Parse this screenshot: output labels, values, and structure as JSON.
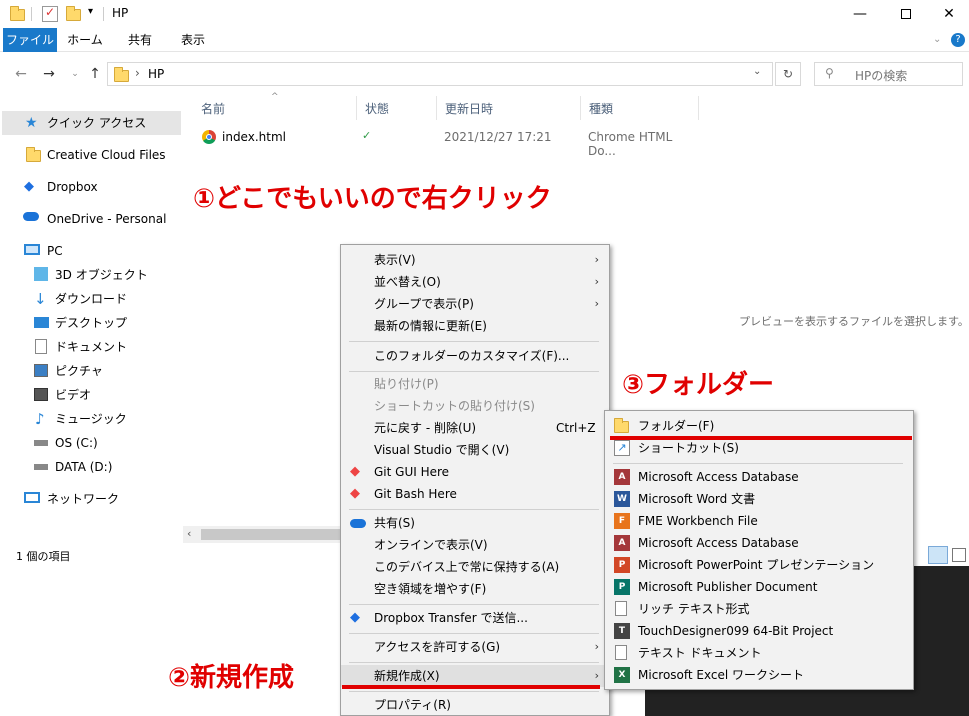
{
  "title": "HP",
  "ribbon": {
    "tabs": [
      "ファイル",
      "ホーム",
      "共有",
      "表示"
    ]
  },
  "address": {
    "path": "HP",
    "separator": "›"
  },
  "search": {
    "placeholder": "HPの検索"
  },
  "sidebar": {
    "items": [
      {
        "label": "クイック アクセス",
        "icon": "star-icon"
      },
      {
        "label": "Creative Cloud Files",
        "icon": "creative-cloud-icon"
      },
      {
        "label": "Dropbox",
        "icon": "dropbox-icon"
      },
      {
        "label": "OneDrive - Personal",
        "icon": "onedrive-icon"
      },
      {
        "label": "PC",
        "icon": "pc-icon"
      },
      {
        "label": "3D オブジェクト",
        "icon": "3d-objects-icon"
      },
      {
        "label": "ダウンロード",
        "icon": "download-icon"
      },
      {
        "label": "デスクトップ",
        "icon": "desktop-icon"
      },
      {
        "label": "ドキュメント",
        "icon": "documents-icon"
      },
      {
        "label": "ピクチャ",
        "icon": "pictures-icon"
      },
      {
        "label": "ビデオ",
        "icon": "videos-icon"
      },
      {
        "label": "ミュージック",
        "icon": "music-icon"
      },
      {
        "label": "OS (C:)",
        "icon": "drive-icon"
      },
      {
        "label": "DATA (D:)",
        "icon": "drive-icon"
      },
      {
        "label": "ネットワーク",
        "icon": "network-icon"
      }
    ]
  },
  "columns": [
    "名前",
    "状態",
    "更新日時",
    "種類"
  ],
  "files": [
    {
      "name": "index.html",
      "status": "✓",
      "modified": "2021/12/27 17:21",
      "type": "Chrome HTML Do..."
    }
  ],
  "preview_text": "プレビューを表示するファイルを選択します。",
  "status_bar": {
    "count": "1 個の項目"
  },
  "context_menu": {
    "items": [
      {
        "label": "表示(V)",
        "submenu": true
      },
      {
        "label": "並べ替え(O)",
        "submenu": true
      },
      {
        "label": "グループで表示(P)",
        "submenu": true
      },
      {
        "label": "最新の情報に更新(E)"
      },
      {
        "label": "このフォルダーのカスタマイズ(F)..."
      },
      {
        "label": "貼り付け(P)",
        "disabled": true
      },
      {
        "label": "ショートカットの貼り付け(S)",
        "disabled": true
      },
      {
        "label": "元に戻す - 削除(U)",
        "shortcut": "Ctrl+Z"
      },
      {
        "label": "Visual Studio で開く(V)"
      },
      {
        "label": "Git GUI Here"
      },
      {
        "label": "Git Bash Here"
      },
      {
        "label": "共有(S)"
      },
      {
        "label": "オンラインで表示(V)"
      },
      {
        "label": "このデバイス上で常に保持する(A)"
      },
      {
        "label": "空き領域を増やす(F)"
      },
      {
        "label": "Dropbox Transfer で送信..."
      },
      {
        "label": "アクセスを許可する(G)",
        "submenu": true
      },
      {
        "label": "新規作成(X)",
        "submenu": true
      },
      {
        "label": "プロパティ(R)"
      }
    ]
  },
  "new_submenu": {
    "items": [
      {
        "label": "フォルダー(F)"
      },
      {
        "label": "ショートカット(S)"
      },
      {
        "label": "Microsoft Access Database"
      },
      {
        "label": "Microsoft Word 文書"
      },
      {
        "label": "FME Workbench File"
      },
      {
        "label": "Microsoft Access Database"
      },
      {
        "label": "Microsoft PowerPoint プレゼンテーション"
      },
      {
        "label": "Microsoft Publisher Document"
      },
      {
        "label": "リッチ テキスト形式"
      },
      {
        "label": "TouchDesigner099 64-Bit Project"
      },
      {
        "label": "テキスト ドキュメント"
      },
      {
        "label": "Microsoft Excel ワークシート"
      }
    ]
  },
  "annotations": {
    "step1": "①どこでもいいので右クリック",
    "step2": "②新規作成",
    "step3": "③フォルダー"
  },
  "colors": {
    "accent": "#1979ca",
    "annotation": "#e00000"
  }
}
